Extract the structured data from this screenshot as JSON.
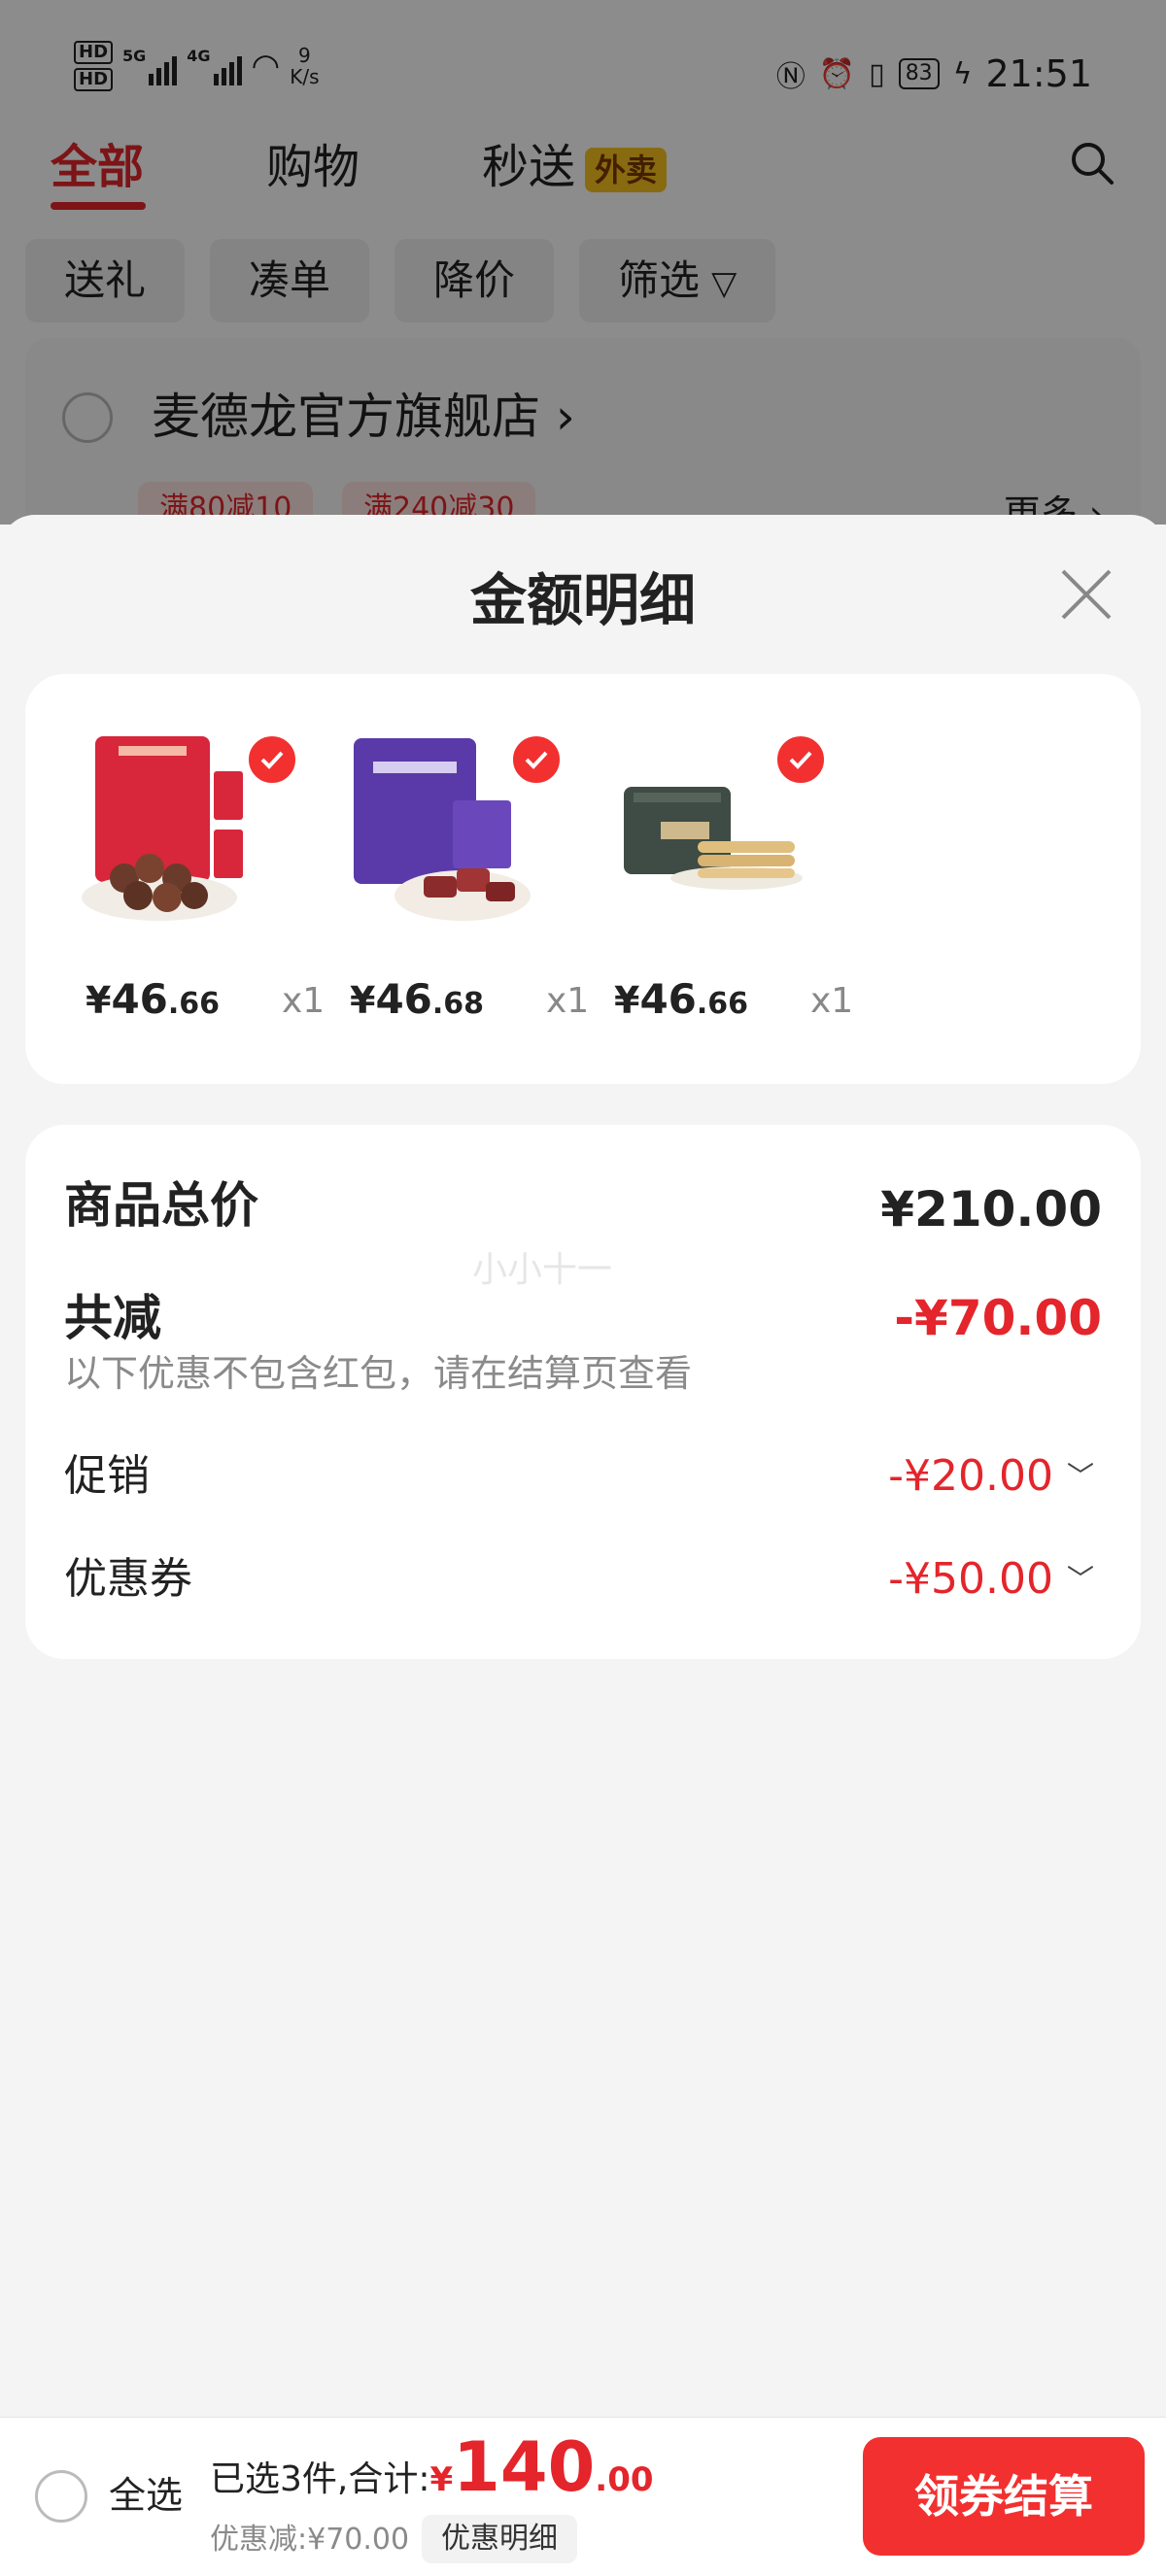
{
  "status_bar": {
    "hd1": "HD",
    "hd2": "HD",
    "net1": "5G",
    "net2": "4G",
    "speed_value": "9",
    "speed_unit": "K/s",
    "battery": "83",
    "time": "21:51"
  },
  "top_tabs": {
    "all": "全部",
    "shopping": "购物",
    "fast": "秒送",
    "fast_badge": "外卖"
  },
  "filters": [
    "送礼",
    "凑单",
    "降价",
    "筛选"
  ],
  "store": {
    "name": "麦德龙官方旗舰店",
    "promos": [
      "满80减10",
      "满240减30"
    ],
    "more": "更多"
  },
  "sheet": {
    "title": "金额明细",
    "products": [
      {
        "name": "Toasted Hazelnuts with cocoa coating",
        "symbol": "¥",
        "price_int": "46",
        "price_dec": ".66",
        "qty": "x1",
        "checked": true
      },
      {
        "name": "Barbecued pork jerky",
        "symbol": "¥",
        "price_int": "46",
        "price_dec": ".68",
        "qty": "x1",
        "checked": true
      },
      {
        "name": "Butter egg rolls tin",
        "symbol": "¥",
        "price_int": "46",
        "price_dec": ".66",
        "qty": "x1",
        "checked": true
      }
    ],
    "summary": {
      "total_label": "商品总价",
      "total_value": "¥210.00",
      "reduce_label": "共减",
      "reduce_value": "-¥70.00",
      "hint": "以下优惠不包含红包，请在结算页查看",
      "promo_label": "促销",
      "promo_value": "-¥20.00",
      "coupon_label": "优惠券",
      "coupon_value": "-¥50.00",
      "watermark": "小小十一"
    }
  },
  "bottom_bar": {
    "select_all": "全选",
    "selected_text": "已选3件,合计:",
    "currency": "¥",
    "total_int": "140",
    "total_dec": ".00",
    "discount_text": "优惠减:¥70.00",
    "detail_button": "优惠明细",
    "checkout_button": "领券结算"
  },
  "colors": {
    "accent_red": "#e4252b",
    "checkout_red": "#f23030",
    "badge_yellow": "#f7c21e"
  }
}
